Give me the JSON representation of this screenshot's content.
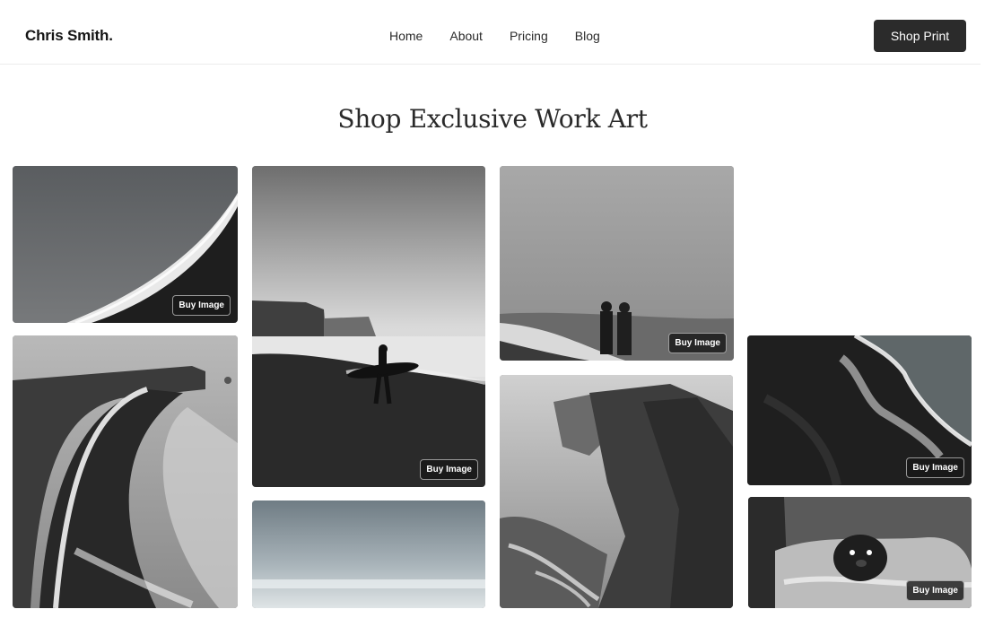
{
  "header": {
    "brand": "Chris Smith.",
    "nav": [
      "Home",
      "About",
      "Pricing",
      "Blog"
    ],
    "cta_label": "Shop Print"
  },
  "main": {
    "title": "Shop Exclusive Work Art",
    "buy_label": "Buy Image"
  },
  "gallery": [
    {
      "id": "black-sand-shoreline",
      "has_buy": true
    },
    {
      "id": "winding-coastline",
      "has_buy": false
    },
    {
      "id": "surfer-silhouette",
      "has_buy": true
    },
    {
      "id": "misty-seascape",
      "has_buy": false
    },
    {
      "id": "couple-by-sea",
      "has_buy": true
    },
    {
      "id": "sea-cliffs",
      "has_buy": false
    },
    {
      "id": "aerial-wave",
      "has_buy": true
    },
    {
      "id": "otter-in-water",
      "has_buy": true
    }
  ],
  "colors": {
    "cta_bg": "#2b2b2b",
    "text": "#1d1d1f",
    "divider": "#ececec"
  }
}
